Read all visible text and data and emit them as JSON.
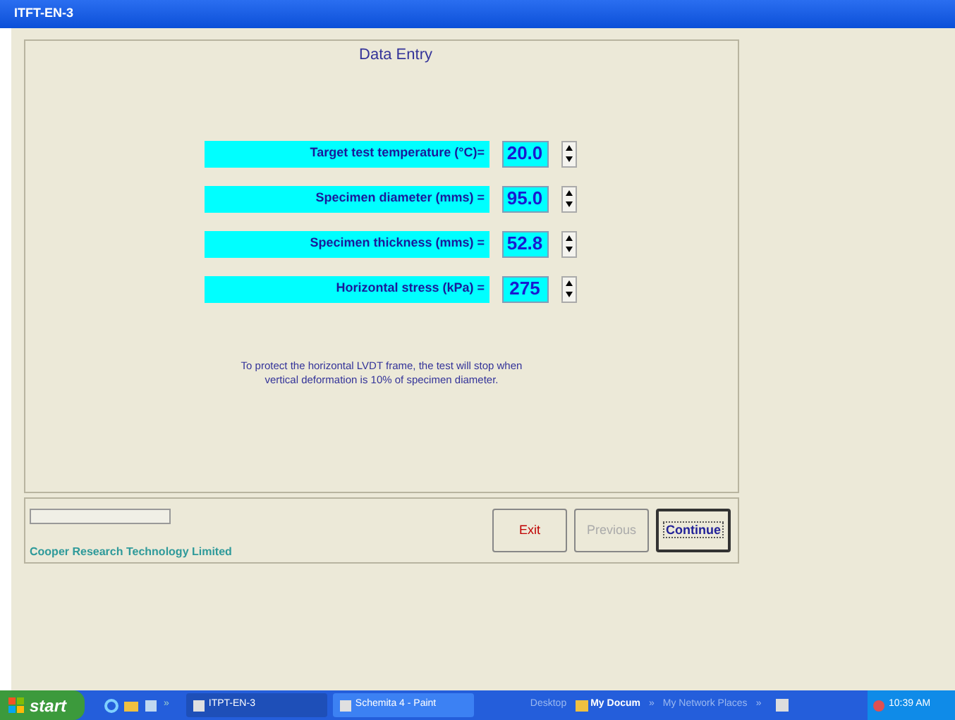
{
  "window": {
    "title": "ITFT-EN-3"
  },
  "panel": {
    "title": "Data Entry"
  },
  "fields": [
    {
      "label": "Target test temperature (°C)=",
      "value": "20.0"
    },
    {
      "label": "Specimen diameter (mms) =",
      "value": "95.0"
    },
    {
      "label": "Specimen thickness (mms) =",
      "value": "52.8"
    },
    {
      "label": "Horizontal stress  (kPa) =",
      "value": "275"
    }
  ],
  "note": "To protect the horizontal LVDT frame, the test will stop when vertical deformation is 10% of specimen diameter.",
  "progress": {
    "level": 0
  },
  "company": "Cooper Research Technology Limited",
  "buttons": [
    {
      "label": "Exit",
      "kind": "exit",
      "disabled": false,
      "focused": false
    },
    {
      "label": "Previous",
      "kind": "normal",
      "disabled": true,
      "focused": false
    },
    {
      "label": "Continue",
      "kind": "normal",
      "disabled": false,
      "focused": true
    }
  ],
  "taskbar": {
    "start": "start",
    "chevron": "»",
    "tasks": [
      {
        "label": "ITPT-EN-3",
        "selected": true
      },
      {
        "label": "Schemita 4 - Paint",
        "selected": false
      }
    ],
    "toolbars": [
      {
        "label": "Desktop",
        "kind": "dim"
      },
      {
        "label": "My Docum",
        "kind": "doc"
      },
      {
        "label": "»",
        "kind": "dim"
      },
      {
        "label": "My Network Places",
        "kind": "dim"
      },
      {
        "label": "»",
        "kind": "dim"
      }
    ],
    "clock": "10:39 AM"
  }
}
